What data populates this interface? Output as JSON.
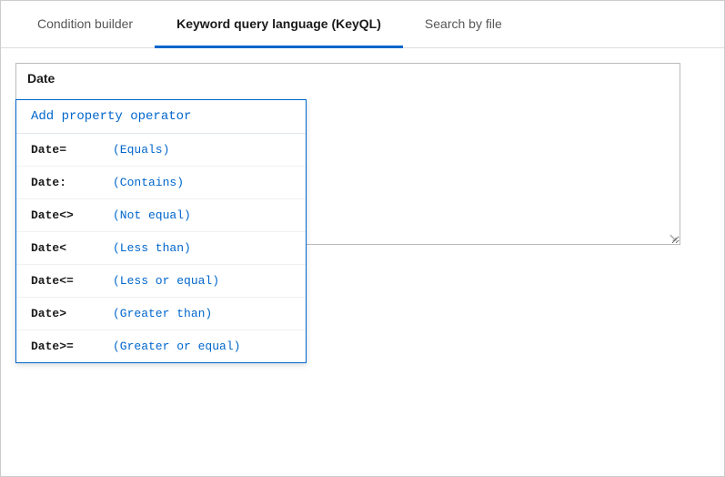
{
  "tabs": [
    {
      "id": "condition-builder",
      "label": "Condition builder",
      "active": false
    },
    {
      "id": "keyword-query",
      "label": "Keyword query language (KeyQL)",
      "active": true
    },
    {
      "id": "search-by-file",
      "label": "Search by file",
      "active": false
    }
  ],
  "date_label": "Date",
  "dropdown": {
    "header_label": "Add property operator",
    "items": [
      {
        "operator": "Date=",
        "description": "(Equals)"
      },
      {
        "operator": "Date:",
        "description": "(Contains)"
      },
      {
        "operator": "Date<>",
        "description": "(Not equal)"
      },
      {
        "operator": "Date<",
        "description": "(Less than)"
      },
      {
        "operator": "Date<=",
        "description": "(Less or equal)"
      },
      {
        "operator": "Date>",
        "description": "(Greater than)"
      },
      {
        "operator": "Date>=",
        "description": "(Greater or equal)"
      }
    ]
  },
  "colors": {
    "active_tab_underline": "#0066cc",
    "blue_text": "#0066cc",
    "border": "#bbb",
    "dropdown_border": "#0066cc"
  }
}
